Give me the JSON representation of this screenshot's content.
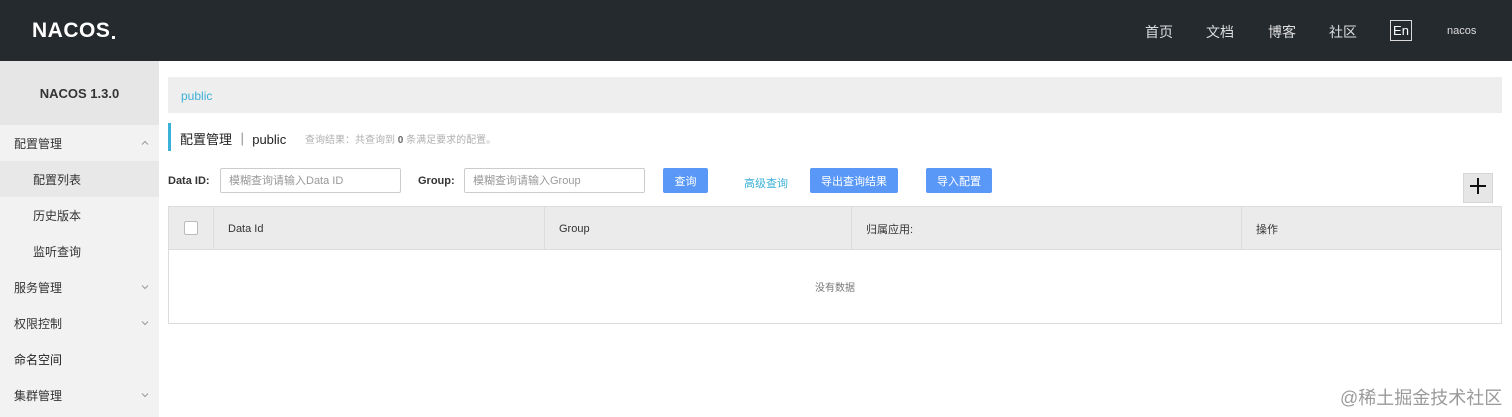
{
  "header": {
    "logo": "NACOS",
    "nav": [
      "首页",
      "文档",
      "博客",
      "社区"
    ],
    "lang": "En",
    "user": "nacos"
  },
  "sidebar": {
    "version": "NACOS 1.3.0",
    "items": [
      {
        "label": "配置管理",
        "expanded": true
      },
      {
        "label": "配置列表"
      },
      {
        "label": "历史版本"
      },
      {
        "label": "监听查询"
      },
      {
        "label": "服务管理"
      },
      {
        "label": "权限控制"
      },
      {
        "label": "命名空间"
      },
      {
        "label": "集群管理"
      }
    ]
  },
  "breadcrumb": "public",
  "page": {
    "title": "配置管理 ｜ public",
    "hint_prefix": "查询结果：共查询到",
    "hint_count": "0",
    "hint_suffix": "条满足要求的配置。"
  },
  "form": {
    "dataid_label": "Data ID:",
    "dataid_placeholder": "模糊查询请输入Data ID",
    "group_label": "Group:",
    "group_placeholder": "模糊查询请输入Group",
    "search_button": "查询",
    "advanced_link": "高级查询",
    "export_button": "导出查询结果",
    "import_button": "导入配置"
  },
  "table": {
    "columns": [
      "Data Id",
      "Group",
      "归属应用:",
      "操作"
    ],
    "empty_text": "没有数据"
  },
  "watermark": "@稀土掘金技术社区",
  "colors": {
    "topbar": "#252a2f",
    "accent": "#3bb0d8",
    "button": "#5a98f7"
  }
}
